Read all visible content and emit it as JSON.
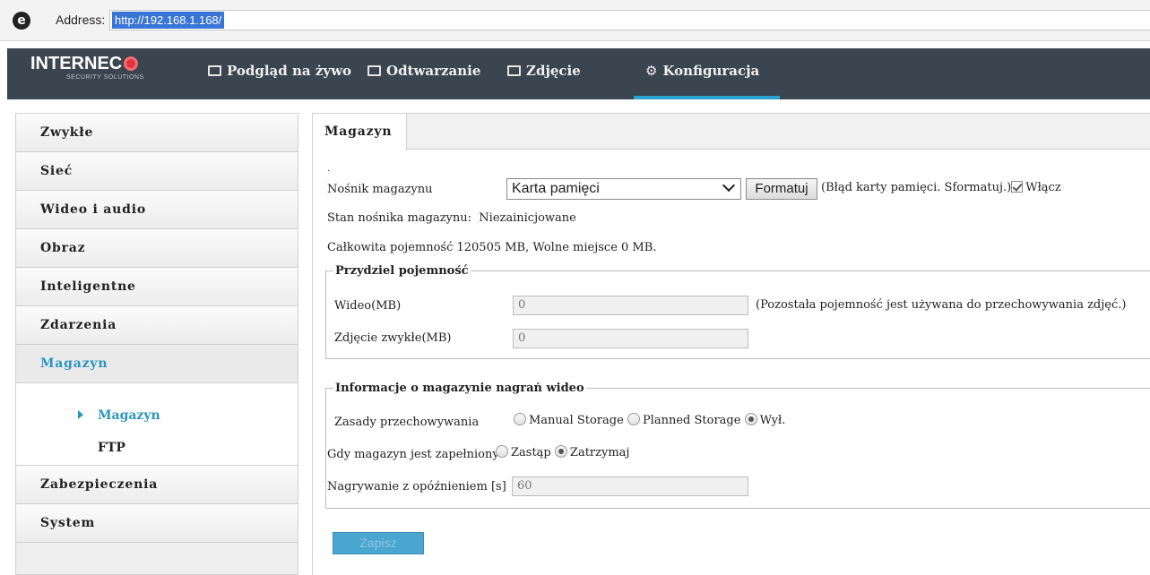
{
  "browser": {
    "address_label": "Address:",
    "url": "http://192.168.1.168/"
  },
  "header": {
    "logo_text": "INTERNEC",
    "logo_sub": "SECURITY SOLUTIONS",
    "nav": [
      {
        "label": "Podgląd na żywo"
      },
      {
        "label": "Odtwarzanie"
      },
      {
        "label": "Zdjęcie"
      },
      {
        "label": "Konfiguracja",
        "active": true
      }
    ]
  },
  "sidebar": {
    "items": [
      {
        "label": "Zwykłe"
      },
      {
        "label": "Sieć"
      },
      {
        "label": "Wideo i audio"
      },
      {
        "label": "Obraz"
      },
      {
        "label": "Inteligentne"
      },
      {
        "label": "Zdarzenia"
      },
      {
        "label": "Magazyn",
        "active": true
      },
      {
        "label": "Zabezpieczenia"
      },
      {
        "label": "System"
      }
    ],
    "subitems": [
      {
        "label": "Magazyn",
        "active": true
      },
      {
        "label": "FTP"
      }
    ]
  },
  "main": {
    "tab": "Magazyn",
    "dot": ".",
    "storage_media_label": "Nośnik magazynu",
    "storage_media_value": "Karta pamięci",
    "format_button": "Formatuj",
    "error_text": "(Błąd karty pamięci. Sformatuj.)",
    "enable_label": "Włącz",
    "status_label": "Stan nośnika magazynu:",
    "status_value": "Niezainicjowane",
    "capacity_text": "Całkowita pojemność  120505  MB,  Wolne miejsce  0  MB.",
    "allocation": {
      "legend": "Przydziel pojemność",
      "video_label": "Wideo(MB)",
      "video_value": "0",
      "video_note": "(Pozostała pojemność jest używana do przechowywania zdjęć.)",
      "photo_label": "Zdjęcie zwykłe(MB)",
      "photo_value": "0"
    },
    "recording": {
      "legend": "Informacje o magazynie nagrań wideo",
      "policy_label": "Zasady przechowywania",
      "policy_options": [
        "Manual Storage",
        "Planned Storage",
        "Wył."
      ],
      "policy_selected": "Wył.",
      "full_label": "Gdy magazyn jest zapełniony",
      "full_options": [
        "Zastąp",
        "Zatrzymaj"
      ],
      "full_selected": "Zatrzymaj",
      "delay_label": "Nagrywanie z opóźnieniem [s]",
      "delay_value": "60"
    },
    "save_button": "Zapisz"
  },
  "colors": {
    "accent": "#2c95bf",
    "nav_bg": "#3b4550",
    "save_bg": "#4aa5cf"
  }
}
